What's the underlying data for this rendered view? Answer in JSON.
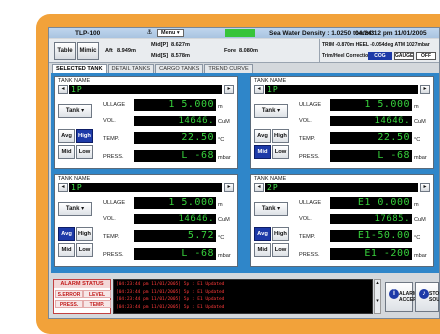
{
  "titlebar": {
    "title": "TLP-100",
    "ship_glyph": "⚓",
    "menu_label": "Menu ▾",
    "sea_water_density": "Sea Water Density : 1.0250 ton/m3",
    "clock": "04:24:12 pm 11/01/2005"
  },
  "info": {
    "table_label": "Table",
    "mimic_label": "Mimic",
    "aft": "Aft",
    "aft_val": "8.949m",
    "midp": "Mid[P]",
    "midp_val": "8.627m",
    "mids": "Mid[S]",
    "mids_val": "8.578m",
    "fore": "Fore",
    "fore_val": "8.080m",
    "trim_heel_atm": "TRIM -0.870m  HEEL -0.054deg  ATM 1027mbar",
    "trim_heel_corr": "Trim/Heel Correction",
    "cog": "COG",
    "gauge": "GAUGE",
    "off": "OFF"
  },
  "tabs": [
    "SELECTED TANK",
    "DETAIL TANKS",
    "CARGO TANKS",
    "TREND CURVE"
  ],
  "panels": [
    {
      "name_label": "TANK NAME",
      "tank_name": "1P",
      "tank_btn": "Tank ▾",
      "ullage_label": "ULLAGE",
      "ullage": "1   5.000",
      "ullage_unit": "m",
      "vol_label": "VOL.",
      "vol": "14646.",
      "vol_unit": "CuM",
      "temp_label": "TEMP.",
      "temp": "22.50",
      "temp_unit": "°C",
      "press_label": "PRESS.",
      "press": "L   -68",
      "press_unit": "mbar",
      "avg": "Avg",
      "high": "High",
      "mid": "Mid",
      "low": "Low",
      "active_mode": "high"
    },
    {
      "name_label": "TANK NAME",
      "tank_name": "1P",
      "tank_btn": "Tank ▾",
      "ullage_label": "ULLAGE",
      "ullage": "1   5.000",
      "ullage_unit": "m",
      "vol_label": "VOL.",
      "vol": "14646.",
      "vol_unit": "CuM",
      "temp_label": "TEMP.",
      "temp": "22.50",
      "temp_unit": "°C",
      "press_label": "PRESS.",
      "press": "L   -68",
      "press_unit": "mbar",
      "avg": "Avg",
      "high": "High",
      "mid": "Mid",
      "low": "Low",
      "active_mode": "mid"
    },
    {
      "name_label": "TANK NAME",
      "tank_name": "1P",
      "tank_btn": "Tank ▾",
      "ullage_label": "ULLAGE",
      "ullage": "1   5.000",
      "ullage_unit": "m",
      "vol_label": "VOL.",
      "vol": "14646.",
      "vol_unit": "CuM",
      "temp_label": "TEMP.",
      "temp": "5.72",
      "temp_unit": "°C",
      "press_label": "PRESS.",
      "press": "L   -68",
      "press_unit": "mbar",
      "avg": "Avg",
      "high": "High",
      "mid": "Mid",
      "low": "Low",
      "active_mode": "avg"
    },
    {
      "name_label": "TANK NAME",
      "tank_name": "2P",
      "tank_btn": "Tank ▾",
      "ullage_label": "ULLAGE",
      "ullage": "E1  0.000",
      "ullage_unit": "m",
      "vol_label": "VOL.",
      "vol": "17685.",
      "vol_unit": "CuM",
      "temp_label": "TEMP.",
      "temp": "E1-50.00",
      "temp_unit": "°C",
      "press_label": "PRESS.",
      "press": "E1  -200",
      "press_unit": "mbar",
      "avg": "Avg",
      "high": "High",
      "mid": "Mid",
      "low": "Low",
      "active_mode": "avg"
    }
  ],
  "status": {
    "alarm_title": "ALARM STATUS",
    "s_error": "S.ERROR",
    "level": "LEVEL",
    "press": "PRESS.",
    "temp": "TEMP.",
    "log": [
      "[04:23:44 pm 11/01/2005] 5p : E1 Updated",
      "[04:23:44 pm 11/01/2005] 5p : E1 Updated",
      "[04:23:44 pm 11/01/2005] 5p : E1 Updated",
      "[04:23:44 pm 11/01/2005] 5p : E1 Updated"
    ],
    "accept_label": "ALARM ACCEPT",
    "stop_label": "STOP SOUND"
  },
  "colors": {
    "frame": "#f2a23a",
    "content_bg": "#2f86c9",
    "led_text": "#37d23c",
    "active_mode": "#1d3aa8",
    "alarm_red": "#c21c1c"
  }
}
